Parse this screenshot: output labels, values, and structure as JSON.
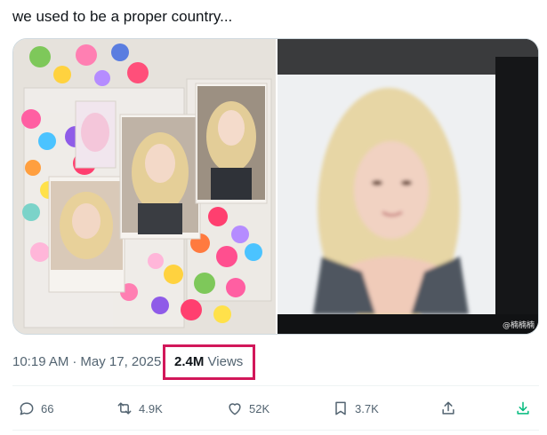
{
  "tweet": {
    "text": "we used to be a proper country..."
  },
  "media": {
    "left_image": "photo of photocards and heart stickers collage",
    "right_image": "blurred photo of a woman with blonde hair",
    "watermark": "@楠楠楠"
  },
  "meta": {
    "time": "10:19 AM",
    "separator": "·",
    "date": "May 17, 2025",
    "views_count": "2.4M",
    "views_label": "Views"
  },
  "actions": {
    "replies": "66",
    "reposts": "4.9K",
    "likes": "52K",
    "bookmarks": "3.7K"
  },
  "colors": {
    "highlight_box": "#d2175a",
    "muted_text": "#536471",
    "download_accent": "#00ba7c"
  }
}
